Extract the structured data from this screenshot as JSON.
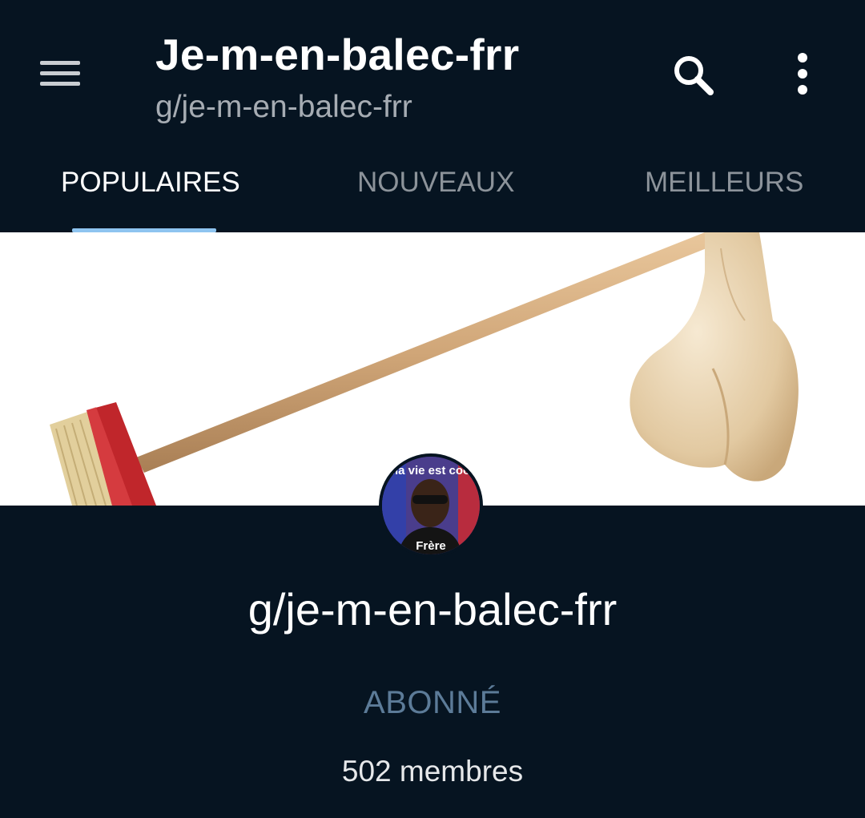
{
  "header": {
    "title": "Je-m-en-balec-frr",
    "subtitle": "g/je-m-en-balec-frr",
    "menu_icon": "hamburger-menu-icon",
    "search_icon": "search-icon",
    "more_icon": "more-vertical-icon"
  },
  "tabs": [
    {
      "label": "POPULAIRES",
      "active": true
    },
    {
      "label": "NOUVEAUX",
      "active": false
    },
    {
      "label": "MEILLEURS",
      "active": false
    }
  ],
  "profile": {
    "avatar_text_top": "Ma vie est cool",
    "avatar_text_bottom": "Frère",
    "name": "g/je-m-en-balec-frr",
    "subscribe_label": "ABONNÉ",
    "members": "502 membres"
  },
  "colors": {
    "background": "#061421",
    "tab_indicator": "#8ec4f0",
    "subscribe": "#5c7b98"
  }
}
